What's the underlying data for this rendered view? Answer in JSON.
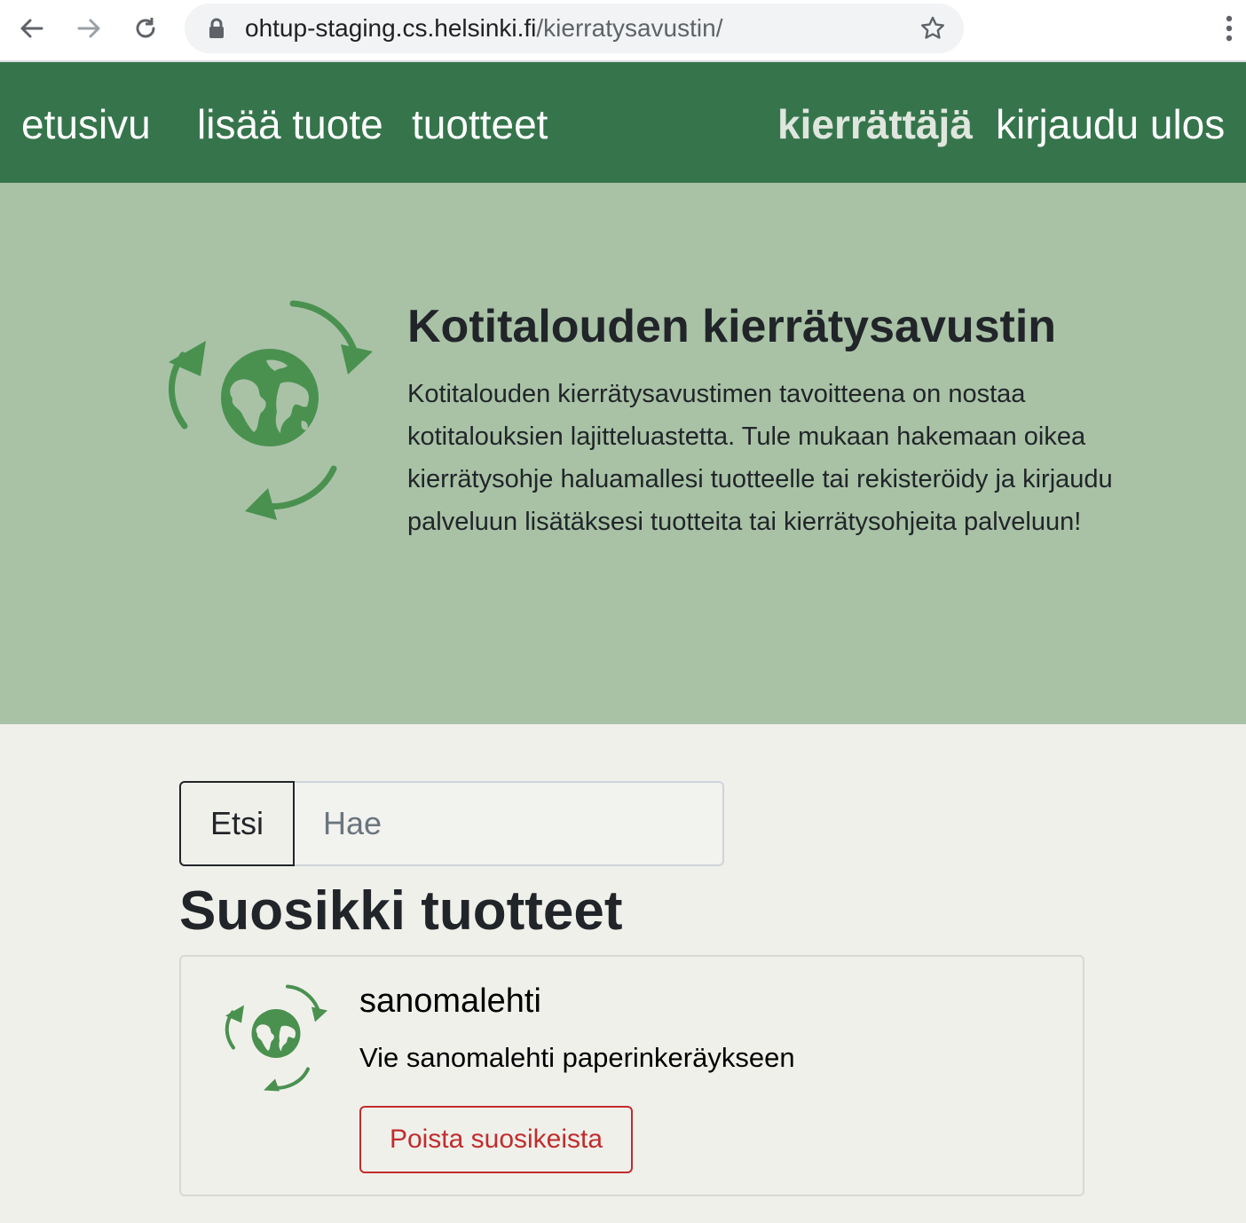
{
  "browser": {
    "url_host": "ohtup-staging.cs.helsinki.fi",
    "url_path": "/kierratysavustin/",
    "icons": [
      "back-arrow-icon",
      "forward-arrow-icon",
      "reload-icon",
      "lock-icon",
      "bookmark-star-icon",
      "more-vert-icon"
    ]
  },
  "nav": {
    "home": "etusivu",
    "add_product": "lisää tuote",
    "products": "tuotteet",
    "username": "kierrättäjä",
    "logout": "kirjaudu ulos"
  },
  "hero": {
    "title": "Kotitalouden kierrätysavustin",
    "text": "Kotitalouden kierrätysavustimen tavoitteena on nostaa kotitalouksien lajitteluastetta. Tule mukaan hakemaan oikea kierrätysohje haluamallesi tuotteelle tai rekisteröidy ja kirjaudu palveluun lisätäksesi tuotteita tai kierrätysohjeita palveluun!"
  },
  "search": {
    "button_label": "Etsi",
    "placeholder": "Hae",
    "value": ""
  },
  "favorites": {
    "heading": "Suosikki tuotteet",
    "items": [
      {
        "name": "sanomalehti",
        "instruction": "Vie sanomalehti paperinkeräykseen",
        "remove_label": "Poista suosikeista"
      }
    ]
  },
  "colors": {
    "nav_bg": "#36754c",
    "hero_bg": "#a9c2a6",
    "page_bg": "#f0f0eb",
    "logo_green": "#4a9150",
    "danger": "#c12d2d"
  }
}
